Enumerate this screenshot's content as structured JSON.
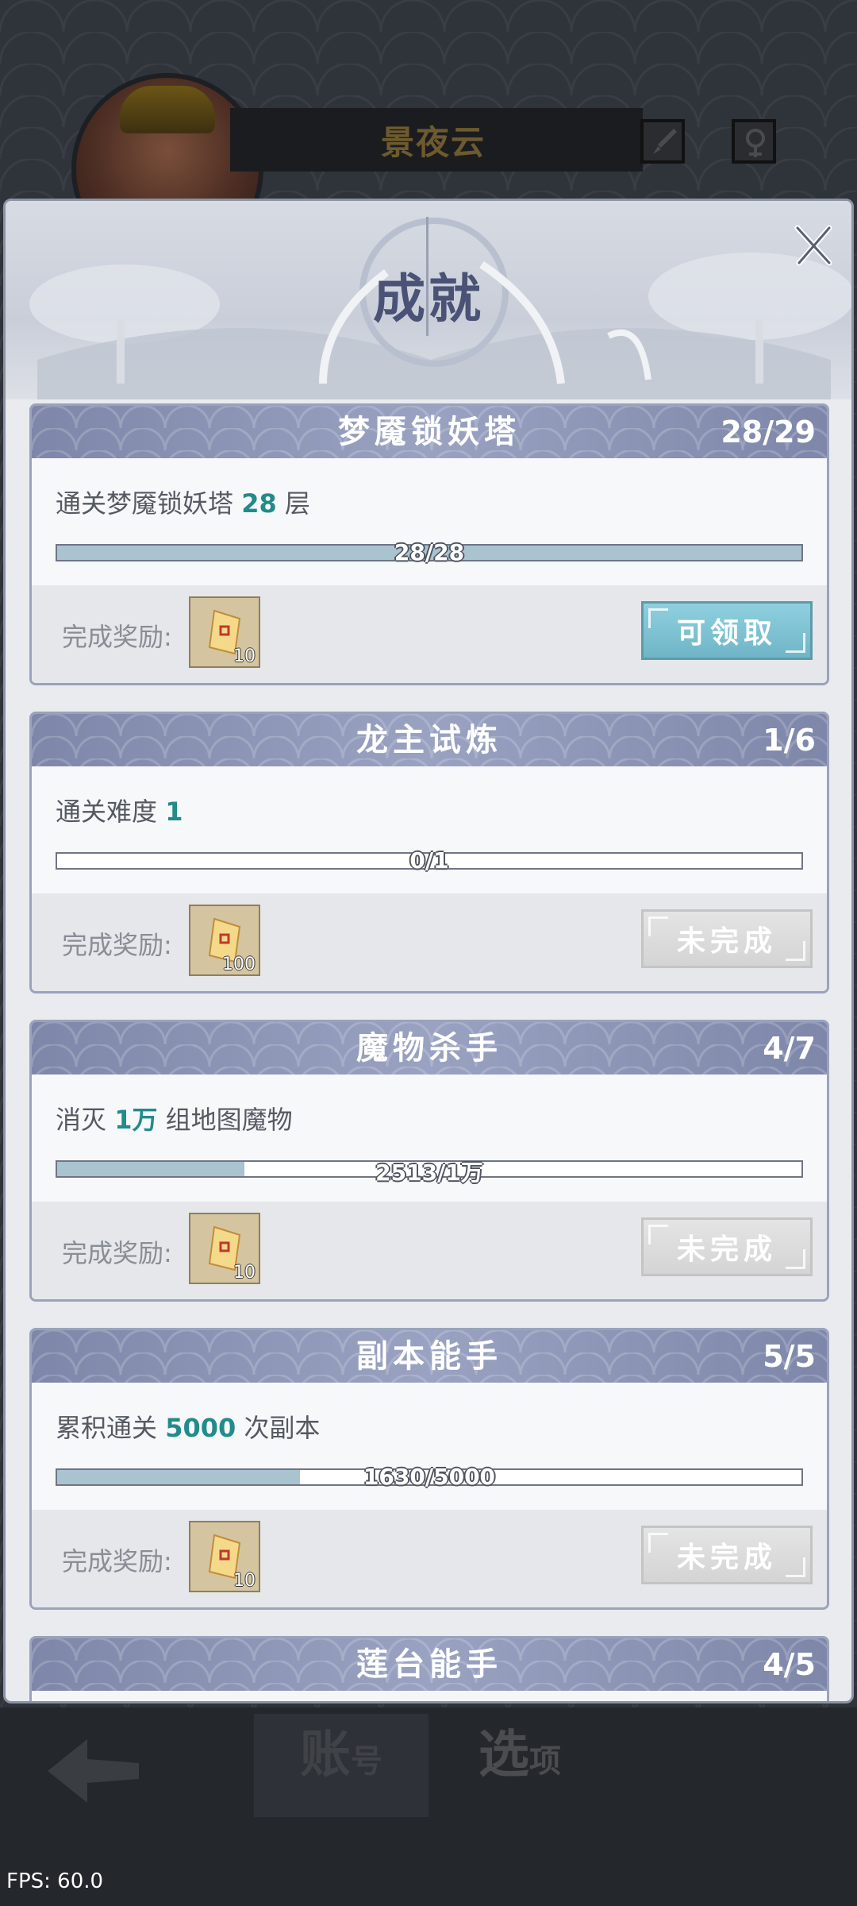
{
  "background": {
    "player_name": "景夜云",
    "tabs": [
      {
        "big": "账",
        "small": "号"
      },
      {
        "big": "选",
        "small": "项"
      }
    ]
  },
  "modal": {
    "title": "成就",
    "reward_label": "完成奖励:",
    "achievements": [
      {
        "title": "梦魇锁妖塔",
        "count": "28/29",
        "desc_pre": "通关梦魇锁妖塔 ",
        "desc_hl": "28",
        "desc_post": " 层",
        "progress_text": "28/28",
        "progress": 1.0,
        "reward_qty": "10",
        "button": "可领取",
        "button_state": "claim"
      },
      {
        "title": "龙主试炼",
        "count": "1/6",
        "desc_pre": "通关难度 ",
        "desc_hl": "1",
        "desc_post": "",
        "progress_text": "0/1",
        "progress": 0.0,
        "reward_qty": "100",
        "button": "未完成",
        "button_state": "locked"
      },
      {
        "title": "魔物杀手",
        "count": "4/7",
        "desc_pre": "消灭 ",
        "desc_hl": "1万",
        "desc_post": " 组地图魔物",
        "progress_text": "2513/1万",
        "progress": 0.2513,
        "reward_qty": "10",
        "button": "未完成",
        "button_state": "locked"
      },
      {
        "title": "副本能手",
        "count": "5/5",
        "desc_pre": "累积通关 ",
        "desc_hl": "5000",
        "desc_post": " 次副本",
        "progress_text": "1630/5000",
        "progress": 0.326,
        "reward_qty": "10",
        "button": "未完成",
        "button_state": "locked"
      },
      {
        "title": "莲台能手",
        "count": "4/5"
      }
    ]
  },
  "fps": "FPS: 60.0",
  "colors": {
    "header": "#8c94b5",
    "highlight": "#228b8b",
    "claim_button": "#7dc3d4",
    "locked_button": "#dcdcdc"
  }
}
